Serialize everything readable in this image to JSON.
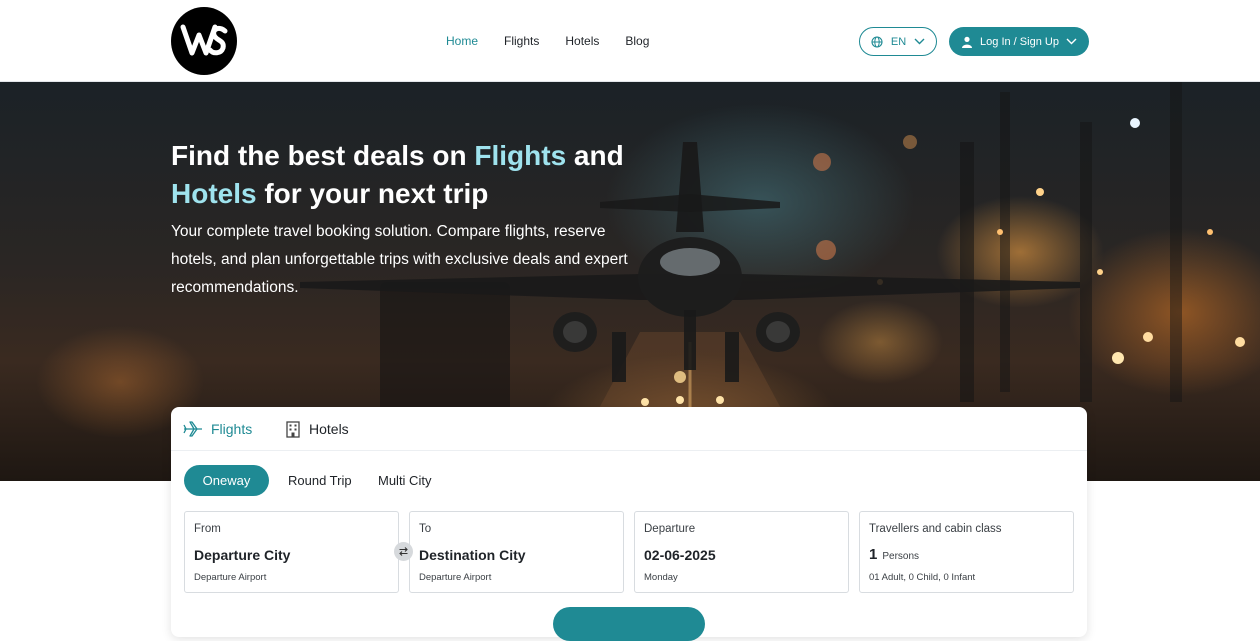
{
  "header": {
    "logo_text": "W",
    "nav": [
      {
        "label": "Home"
      },
      {
        "label": "Flights"
      },
      {
        "label": "Hotels"
      },
      {
        "label": "Blog"
      }
    ],
    "language": {
      "label": "EN",
      "icon": "globe-icon"
    },
    "login": {
      "label": "Log In / Sign Up",
      "icon": "user-icon"
    }
  },
  "hero": {
    "title_part1": "Find the best deals on ",
    "title_highlight1": "Flights",
    "title_part2": " and ",
    "title_highlight2": "Hotels",
    "title_part3": " for your next trip",
    "subtitle": "Your complete travel booking solution. Compare flights, reserve hotels, and plan unforgettable trips with exclusive deals and expert recommendations."
  },
  "search": {
    "tabs": [
      {
        "label": "Flights",
        "icon": "airplane-icon",
        "active": true
      },
      {
        "label": "Hotels",
        "icon": "building-icon",
        "active": false
      }
    ],
    "trip_types": [
      {
        "label": "Oneway",
        "active": true
      },
      {
        "label": "Round Trip",
        "active": false
      },
      {
        "label": "Multi City",
        "active": false
      }
    ],
    "from": {
      "label": "From",
      "value": "Departure City",
      "sub": "Departure Airport"
    },
    "to": {
      "label": "To",
      "value": "Destination City",
      "sub": "Departure Airport"
    },
    "departure": {
      "label": "Departure",
      "value": "02-06-2025",
      "sub": "Monday"
    },
    "travellers": {
      "label": "Travellers and cabin class",
      "count": "1",
      "unit": "Persons",
      "sub": "01 Adult, 0 Child, 0 Infant"
    }
  },
  "colors": {
    "accent": "#1f8a94",
    "highlight": "#9fe3ee"
  }
}
